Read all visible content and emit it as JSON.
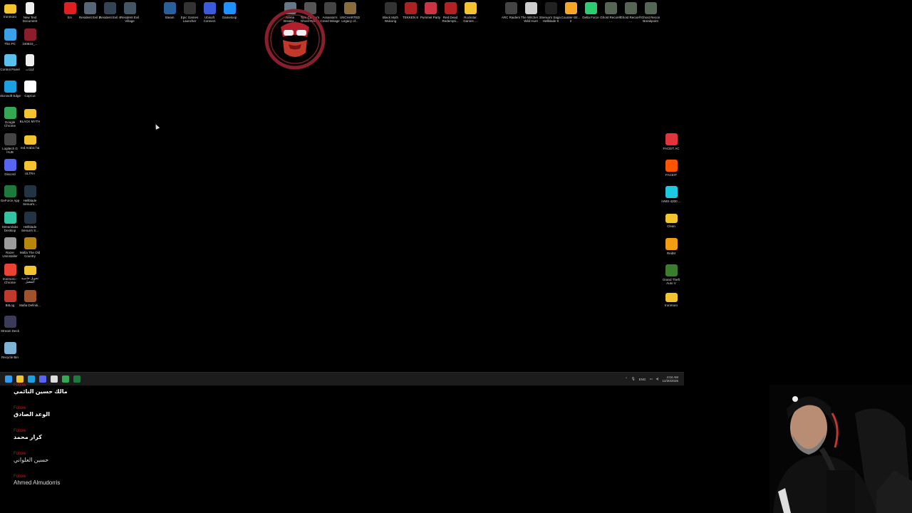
{
  "desktop": {
    "left_columns": [
      [
        {
          "label": "Ironmoro",
          "icon": "folder-icon",
          "color": "#f4c430"
        },
        {
          "label": "This PC",
          "icon": "monitor-icon",
          "color": "#3aa0e8"
        },
        {
          "label": "Control Panel",
          "icon": "control-panel-icon",
          "color": "#5bc0eb"
        },
        {
          "label": "Microsoft Edge",
          "icon": "edge-icon",
          "color": "#1ba1e2"
        },
        {
          "label": "Google Chrome",
          "icon": "chrome-icon",
          "color": "#34a853"
        },
        {
          "label": "Logitech G HUB",
          "icon": "logitech-icon",
          "color": "#444444"
        },
        {
          "label": "Discord",
          "icon": "discord-icon",
          "color": "#5865f2"
        },
        {
          "label": "GeForce App",
          "icon": "geforce-icon",
          "color": "#1e7a3c"
        },
        {
          "label": "Streamlabs Desktop",
          "icon": "streamlabs-icon",
          "color": "#31c3a2"
        },
        {
          "label": "Razer Uninstaller",
          "icon": "razer-icon",
          "color": "#9b9b9b"
        },
        {
          "label": "Ironmoro - Chrome",
          "icon": "chrome-icon",
          "color": "#ea4335"
        },
        {
          "label": "BitLog",
          "icon": "bitlog-icon",
          "color": "#c0392b"
        },
        {
          "label": "Stream Deck",
          "icon": "stream-deck-icon",
          "color": "#3a3a5a"
        },
        {
          "label": "Recycle Bin",
          "icon": "recycle-bin-icon",
          "color": "#7fb3d5"
        }
      ],
      [
        {
          "label": "New Text Document",
          "icon": "document-icon",
          "color": "#eeeeee"
        },
        {
          "label": "240810_...",
          "icon": "pdf-icon",
          "color": "#8b1e2d"
        },
        {
          "label": "كتابات",
          "icon": "document-icon",
          "color": "#eeeeee"
        },
        {
          "label": "CapCut",
          "icon": "capcut-icon",
          "color": "#ffffff"
        },
        {
          "label": "BLACK MYTH",
          "icon": "folder-icon",
          "color": "#f4c430"
        },
        {
          "label": "red Arabic ha",
          "icon": "folder-icon",
          "color": "#f4c430"
        },
        {
          "label": "ULTRA",
          "icon": "folder-icon",
          "color": "#f4c430"
        },
        {
          "label": "Hellblade Senua's...",
          "icon": "hellblade-icon",
          "color": "#223344"
        },
        {
          "label": "Hellblade Senua's S...",
          "icon": "hellblade-icon",
          "color": "#223344"
        },
        {
          "label": "Mafia The Old Country",
          "icon": "mafia-icon",
          "color": "#b8860b"
        },
        {
          "label": "تحويل خاصية التفعيل",
          "icon": "folder-icon",
          "color": "#f4c430"
        },
        {
          "label": "Mafia Definiti...",
          "icon": "mafia-icon",
          "color": "#a0522d"
        }
      ]
    ],
    "top_row": [
      {
        "label": "EA",
        "icon": "ea-icon",
        "color": "#e02020"
      },
      {
        "label": "Resident Evil 2",
        "icon": "game-icon",
        "color": "#556677"
      },
      {
        "label": "Resident Evil 4",
        "icon": "game-icon",
        "color": "#334455"
      },
      {
        "label": "Resident Evil Village",
        "icon": "game-icon",
        "color": "#445566"
      },
      {
        "label": "Steam",
        "icon": "steam-icon",
        "color": "#2a5f9e"
      },
      {
        "label": "Epic Games Launcher",
        "icon": "epic-icon",
        "color": "#333333"
      },
      {
        "label": "Ubisoft Connect",
        "icon": "ubisoft-icon",
        "color": "#3b5bdb"
      },
      {
        "label": "Gameloop",
        "icon": "gameloop-icon",
        "color": "#1e90ff"
      },
      {
        "label": "Arena Breako...",
        "icon": "game-icon",
        "color": "#667788"
      },
      {
        "label": "Tom Clancy's Ghost Recon",
        "icon": "game-icon",
        "color": "#555555"
      },
      {
        "label": "Assassin's Creed Mirage",
        "icon": "game-icon",
        "color": "#444444"
      },
      {
        "label": "UNCHARTED Legacy of...",
        "icon": "game-icon",
        "color": "#8a6d3b"
      },
      {
        "label": "Black Myth Wukong",
        "icon": "game-icon",
        "color": "#333333"
      },
      {
        "label": "TEKKEN 8",
        "icon": "game-icon",
        "color": "#aa2222"
      },
      {
        "label": "Pummel Party",
        "icon": "game-icon",
        "color": "#cc3344"
      },
      {
        "label": "Red Dead Redempti...",
        "icon": "game-icon",
        "color": "#b22222"
      },
      {
        "label": "Rockstar Games ...",
        "icon": "rockstar-icon",
        "color": "#f4c430"
      },
      {
        "label": "ARC Raiders",
        "icon": "game-icon",
        "color": "#444444"
      },
      {
        "label": "The Witcher 3 Wild Hunt",
        "icon": "game-icon",
        "color": "#cccccc"
      },
      {
        "label": "Senua's Saga Hellblade II",
        "icon": "game-icon",
        "color": "#222222"
      },
      {
        "label": "Counter-Str... 2",
        "icon": "cs2-icon",
        "color": "#f5a623"
      },
      {
        "label": "Delta Force",
        "icon": "game-icon",
        "color": "#2ecc71"
      },
      {
        "label": "Ghost Recon® ...",
        "icon": "game-icon",
        "color": "#556655"
      },
      {
        "label": "Ghost Recon® ...",
        "icon": "game-icon",
        "color": "#556655"
      },
      {
        "label": "Ghost Recon Breakpoint",
        "icon": "game-icon",
        "color": "#556655"
      }
    ],
    "right_column": [
      {
        "label": "FACEIT AC",
        "icon": "faceit-ac-icon",
        "color": "#e0353b"
      },
      {
        "label": "FACEIT",
        "icon": "faceit-icon",
        "color": "#ff5500"
      },
      {
        "label": "iVMS-4200 ...",
        "icon": "ivms-icon",
        "color": "#1ec8e0"
      },
      {
        "label": "Clean",
        "icon": "folder-icon",
        "color": "#f4c430"
      },
      {
        "label": "RedM",
        "icon": "redm-icon",
        "color": "#f39c12"
      },
      {
        "label": "Grand Theft Auto V",
        "icon": "gta-icon",
        "color": "#3a7d2c"
      },
      {
        "label": "Ironmoro",
        "icon": "folder-icon",
        "color": "#f4c430"
      }
    ]
  },
  "taskbar": {
    "apps": [
      {
        "icon": "windows-start-icon",
        "color": "#2f9cf4"
      },
      {
        "icon": "file-explorer-icon",
        "color": "#f4c430"
      },
      {
        "icon": "edge-icon",
        "color": "#1ba1e2"
      },
      {
        "icon": "discord-icon",
        "color": "#5865f2"
      },
      {
        "icon": "calendar-icon",
        "color": "#dddddd"
      },
      {
        "icon": "chrome-icon",
        "color": "#34a853"
      },
      {
        "icon": "xbox-icon",
        "color": "#1e7a3c"
      }
    ],
    "tray": {
      "language": "ENG",
      "time": "4:04 AM",
      "date": "12/30/2025"
    }
  },
  "follow_alerts": [
    {
      "kind": "Follow",
      "name": "مالك حسين النائمي"
    },
    {
      "kind": "Follow",
      "name": "الوعد الصادق"
    },
    {
      "kind": "Follow",
      "name": "كرار محمد"
    },
    {
      "kind": "Follow",
      "name": "حسين العلواني"
    },
    {
      "kind": "Follow",
      "name": "Ahmed Almudorris"
    }
  ]
}
